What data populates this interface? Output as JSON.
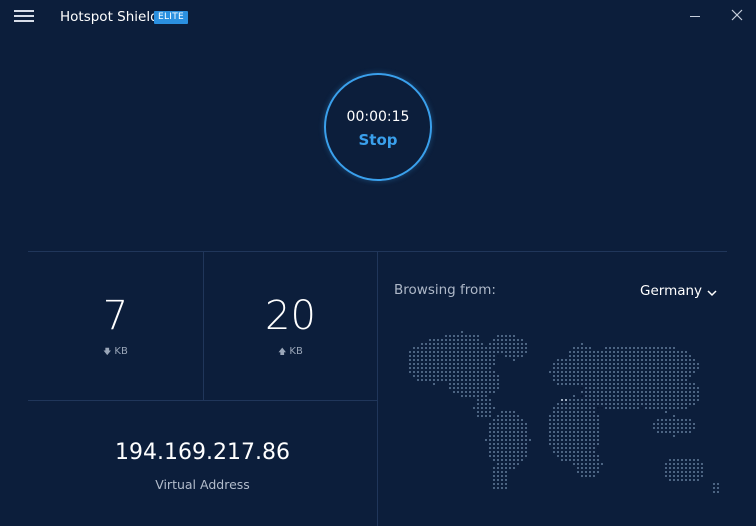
{
  "app": {
    "title": "Hotspot Shield",
    "badge": "ELITE"
  },
  "connection": {
    "timer": "00:00:15",
    "action_label": "Stop",
    "accent_color": "#3aa0ec"
  },
  "stats": {
    "download": {
      "value": "7",
      "unit": "KB",
      "icon": "arrow-down-icon"
    },
    "upload": {
      "value": "20",
      "unit": "KB",
      "icon": "arrow-up-icon"
    }
  },
  "address": {
    "ip": "194.169.217.86",
    "label": "Virtual Address"
  },
  "location": {
    "label": "Browsing from:",
    "selected": "Germany"
  },
  "icons": {
    "menu": "hamburger-menu-icon",
    "minimize": "minimize-icon",
    "close": "close-icon",
    "dropdown": "chevron-down-icon",
    "map": "world-map-dots"
  },
  "colors": {
    "background": "#0c1e3b",
    "divider": "#20365a",
    "badge": "#2b90e0",
    "map_dot": "#5f7896",
    "map_dot_highlight": "#c8d6e6"
  }
}
